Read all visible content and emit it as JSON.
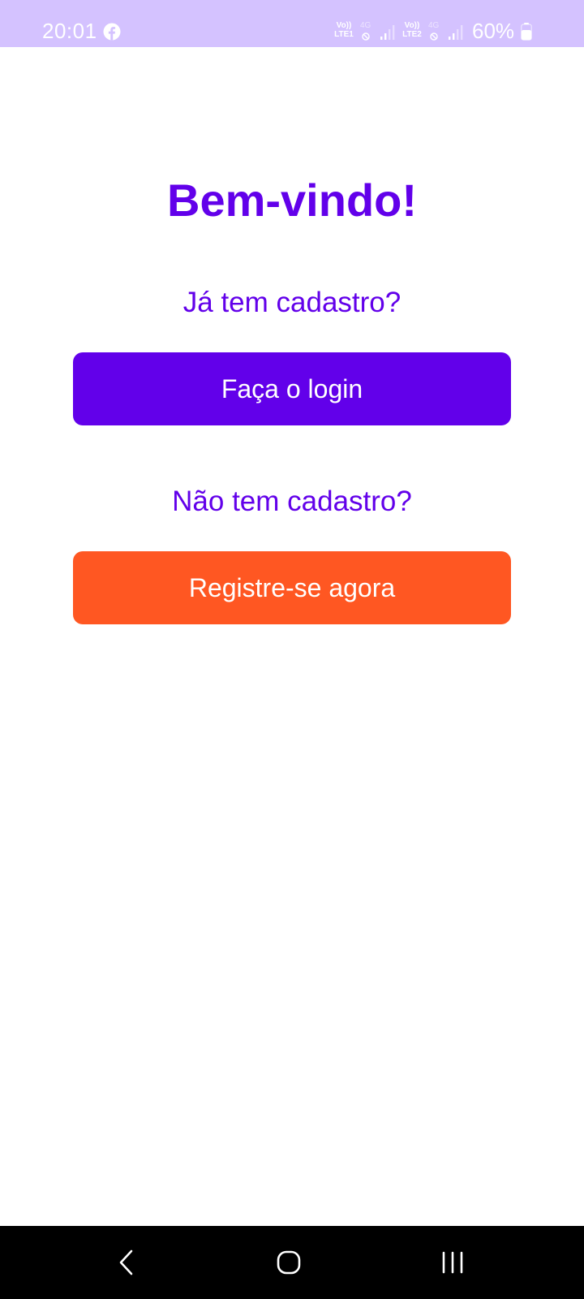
{
  "status_bar": {
    "time": "20:01",
    "notification_icon": "facebook-icon",
    "sim1": {
      "volte": "Vo))",
      "lte": "LTE1",
      "network": "4G"
    },
    "sim2": {
      "volte": "Vo))",
      "lte": "LTE2",
      "network": "4G"
    },
    "battery": "60%",
    "background_color": "#d4c2ff"
  },
  "main": {
    "title": "Bem-vindo!",
    "login_prompt": "Já tem cadastro?",
    "login_button": "Faça o login",
    "register_prompt": "Não tem cadastro?",
    "register_button": "Registre-se agora"
  },
  "colors": {
    "primary": "#6200ea",
    "accent": "#ff5722",
    "background": "#ffffff"
  },
  "nav_bar": {
    "icons": [
      "back-icon",
      "home-icon",
      "recent-apps-icon"
    ]
  }
}
